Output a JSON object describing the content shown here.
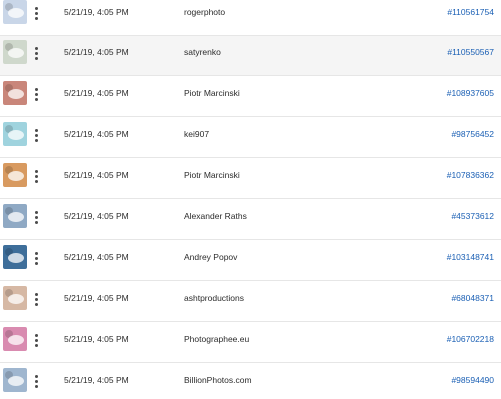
{
  "rows": [
    {
      "thumb_color": "#c9d6e8",
      "date": "5/21/19, 4:05 PM",
      "author": "rogerphoto",
      "asset_id": "#110561754",
      "highlighted": false
    },
    {
      "thumb_color": "#cfd8cc",
      "date": "5/21/19, 4:05 PM",
      "author": "satyrenko",
      "asset_id": "#110550567",
      "highlighted": true
    },
    {
      "thumb_color": "#c9867a",
      "date": "5/21/19, 4:05 PM",
      "author": "Piotr Marcinski",
      "asset_id": "#108937605",
      "highlighted": false
    },
    {
      "thumb_color": "#9fd3de",
      "date": "5/21/19, 4:05 PM",
      "author": "kei907",
      "asset_id": "#98756452",
      "highlighted": false
    },
    {
      "thumb_color": "#d89a60",
      "date": "5/21/19, 4:05 PM",
      "author": "Piotr Marcinski",
      "asset_id": "#107836362",
      "highlighted": false
    },
    {
      "thumb_color": "#8fa9c4",
      "date": "5/21/19, 4:05 PM",
      "author": "Alexander Raths",
      "asset_id": "#45373612",
      "highlighted": false
    },
    {
      "thumb_color": "#3e6e9a",
      "date": "5/21/19, 4:05 PM",
      "author": "Andrey Popov",
      "asset_id": "#103148741",
      "highlighted": false
    },
    {
      "thumb_color": "#d6b8a4",
      "date": "5/21/19, 4:05 PM",
      "author": "ashtproductions",
      "asset_id": "#68048371",
      "highlighted": false
    },
    {
      "thumb_color": "#d98bb0",
      "date": "5/21/19, 4:05 PM",
      "author": "Photographee.eu",
      "asset_id": "#106702218",
      "highlighted": false
    },
    {
      "thumb_color": "#9fb6cf",
      "date": "5/21/19, 4:05 PM",
      "author": "BillionPhotos.com",
      "asset_id": "#98594490",
      "highlighted": false
    }
  ],
  "icons": {
    "row_menu": "more-vertical-icon"
  }
}
